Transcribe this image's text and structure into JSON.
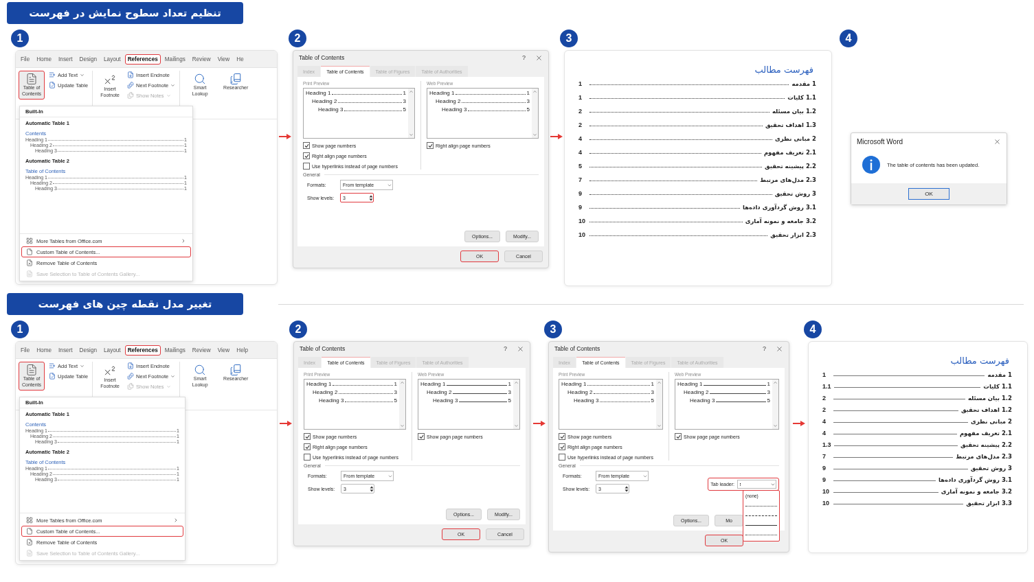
{
  "sections": [
    {
      "title": "تنظیم تعداد سطوح نمایش در فهرست",
      "steps": [
        {
          "number": "1",
          "kind": "ribbon",
          "tabs": [
            {
              "label": "File",
              "selected": false,
              "highlighted": false
            },
            {
              "label": "Home",
              "selected": false,
              "highlighted": false
            },
            {
              "label": "Insert",
              "selected": false,
              "highlighted": false
            },
            {
              "label": "Design",
              "selected": false,
              "highlighted": false
            },
            {
              "label": "Layout",
              "selected": false,
              "highlighted": false
            },
            {
              "label": "References",
              "selected": true,
              "highlighted": true
            },
            {
              "label": "Mailings",
              "selected": false,
              "highlighted": false
            },
            {
              "label": "Review",
              "selected": false,
              "highlighted": false
            },
            {
              "label": "View",
              "selected": false,
              "highlighted": false
            },
            {
              "label": "He",
              "selected": false,
              "highlighted": false
            }
          ],
          "toc_button": {
            "label": "Table of Contents",
            "highlighted": true
          },
          "toc_commands": [
            {
              "label": "Add Text",
              "dropdown": true,
              "disabled": false
            },
            {
              "label": "Update Table",
              "dropdown": false,
              "disabled": false
            }
          ],
          "footnote_button": {
            "label": "Insert Footnote"
          },
          "footnote_commands": [
            {
              "label": "Insert Endnote",
              "dropdown": false,
              "disabled": false
            },
            {
              "label": "Next Footnote",
              "dropdown": true,
              "disabled": false
            },
            {
              "label": "Show Notes",
              "dropdown": true,
              "disabled": true
            }
          ],
          "tool_buttons": [
            {
              "label": "Smart Lookup"
            },
            {
              "label": "Researcher"
            }
          ],
          "menu": {
            "header": "Built-In",
            "galleries": [
              {
                "name": "Automatic Table 1",
                "heading": "Contents",
                "entries": [
                  {
                    "label": "Heading 1",
                    "page": "1",
                    "children": [
                      {
                        "label": "Heading 2",
                        "page": "1",
                        "children": [
                          {
                            "label": "Heading 3",
                            "page": "1"
                          }
                        ]
                      }
                    ]
                  }
                ]
              },
              {
                "name": "Automatic Table 2",
                "heading": "Table of Contents",
                "entries": [
                  {
                    "label": "Heading 1",
                    "page": "1",
                    "children": [
                      {
                        "label": "Heading 2",
                        "page": "1",
                        "children": [
                          {
                            "label": "Heading 3",
                            "page": "1"
                          }
                        ]
                      }
                    ]
                  }
                ]
              }
            ],
            "items": [
              {
                "label": "More Tables from Office.com",
                "submenu": true,
                "highlighted": false,
                "disabled": false
              },
              {
                "label": "Custom Table of Contents...",
                "submenu": false,
                "highlighted": true,
                "disabled": false
              },
              {
                "label": "Remove Table of Contents",
                "submenu": false,
                "highlighted": false,
                "disabled": false
              },
              {
                "label": "Save Selection to Table of Contents Gallery...",
                "submenu": false,
                "highlighted": false,
                "disabled": true
              }
            ]
          }
        },
        {
          "number": "2",
          "kind": "dialog",
          "arrow_before": true,
          "title": "Table of Contents",
          "help": "?",
          "tabs": [
            {
              "label": "Index",
              "selected": false
            },
            {
              "label": "Table of Contents",
              "selected": true
            },
            {
              "label": "Table of Figures",
              "selected": false
            },
            {
              "label": "Table of Authorities",
              "selected": false
            }
          ],
          "print_preview": {
            "label": "Print Preview",
            "leader": {
              "kind": "dots"
            },
            "entries": [
              {
                "label": "Heading 1",
                "page": "1",
                "children": [
                  {
                    "label": "Heading 2",
                    "page": "3",
                    "children": [
                      {
                        "label": "Heading 3",
                        "page": "5"
                      }
                    ]
                  }
                ]
              }
            ]
          },
          "web_preview": {
            "label": "Web Preview",
            "leader": {
              "kind": "dots"
            },
            "entries": [
              {
                "label": "Heading 1",
                "page": "1",
                "children": [
                  {
                    "label": "Heading 2",
                    "page": "3",
                    "children": [
                      {
                        "label": "Heading 3",
                        "page": "5"
                      }
                    ]
                  }
                ]
              }
            ]
          },
          "print_options": [
            {
              "label": "Show page numbers",
              "checked": true
            },
            {
              "label": "Right align page numbers",
              "checked": true
            },
            {
              "label": "Use hyperlinks instead of page numbers",
              "checked": false
            }
          ],
          "web_options": [
            {
              "label": "Right align page numbers",
              "checked": true
            }
          ],
          "general": {
            "label": "General",
            "formats_label": "Formats:",
            "formats": "From template",
            "levels_label": "Show levels:",
            "levels": "3",
            "levels_highlighted": true
          },
          "buttons": [
            {
              "label": "Options...",
              "highlighted": false
            },
            {
              "label": "Modify...",
              "highlighted": false
            }
          ],
          "footer_buttons": [
            {
              "label": "OK",
              "highlighted": true
            },
            {
              "label": "Cancel",
              "highlighted": false
            }
          ]
        },
        {
          "number": "3",
          "kind": "toc",
          "arrow_before": true,
          "title": "فهرست مطالب",
          "leader": {
            "kind": "dots"
          },
          "entries": [
            {
              "title": "1 مقدمه",
              "page": "1"
            },
            {
              "title": "1.1 کلیات",
              "page": "1"
            },
            {
              "title": "1.2 بیان مسئله",
              "page": "2"
            },
            {
              "title": "1.3 اهداف تحقیق",
              "page": "2"
            },
            {
              "title": "2 مبانی نظری",
              "page": "4"
            },
            {
              "title": "2.1 تعریف مفهوم",
              "page": "4"
            },
            {
              "title": "2.2 پیشینه تحقیق",
              "page": "5"
            },
            {
              "title": "2.3 مدل‌های مرتبط",
              "page": "7"
            },
            {
              "title": "3 روش تحقیق",
              "page": "9"
            },
            {
              "title": "3.1 روش گردآوری داده‌ها",
              "page": "9"
            },
            {
              "title": "3.2 جامعه و نمونه آماری",
              "page": "10"
            },
            {
              "title": "2.3 ابزار تحقیق",
              "page": "10"
            }
          ]
        },
        {
          "number": "4",
          "kind": "message",
          "arrow_before": false,
          "title": "Microsoft Word",
          "message": "The table of contents has been updated.",
          "button": "OK"
        }
      ]
    },
    {
      "title": "تغییر مدل نقطه چین های فهرست",
      "steps": [
        {
          "number": "1",
          "kind": "ribbon",
          "tabs": [
            {
              "label": "File",
              "selected": false,
              "highlighted": false
            },
            {
              "label": "Home",
              "selected": false,
              "highlighted": false
            },
            {
              "label": "Insert",
              "selected": false,
              "highlighted": false
            },
            {
              "label": "Design",
              "selected": false,
              "highlighted": false
            },
            {
              "label": "Layout",
              "selected": false,
              "highlighted": false
            },
            {
              "label": "References",
              "selected": true,
              "highlighted": true
            },
            {
              "label": "Mailings",
              "selected": false,
              "highlighted": false
            },
            {
              "label": "Review",
              "selected": false,
              "highlighted": false
            },
            {
              "label": "View",
              "selected": false,
              "highlighted": false
            },
            {
              "label": "Help",
              "selected": false,
              "highlighted": false
            }
          ],
          "toc_button": {
            "label": "Table of Contents",
            "highlighted": true
          },
          "toc_commands": [
            {
              "label": "Add Text",
              "dropdown": true,
              "disabled": false
            },
            {
              "label": "Update Table",
              "dropdown": false,
              "disabled": false
            }
          ],
          "footnote_button": {
            "label": "Insert Footnote"
          },
          "footnote_commands": [
            {
              "label": "Insert Endnote",
              "dropdown": false,
              "disabled": false
            },
            {
              "label": "Next Footnote",
              "dropdown": true,
              "disabled": false
            },
            {
              "label": "Show Notes",
              "dropdown": true,
              "disabled": true
            }
          ],
          "tool_buttons": [
            {
              "label": "Smart Lookup"
            },
            {
              "label": "Researcher"
            }
          ],
          "menu": {
            "header": "Built-In",
            "galleries": [
              {
                "name": "Automatic Table 1",
                "heading": "Contents",
                "entries": [
                  {
                    "label": "Heading 1",
                    "page": "1",
                    "children": [
                      {
                        "label": "Heading 2",
                        "page": "1",
                        "children": [
                          {
                            "label": "Heading 3",
                            "page": "1"
                          }
                        ]
                      }
                    ]
                  }
                ]
              },
              {
                "name": "Automatic Table 2",
                "heading": "Table of Contents",
                "entries": [
                  {
                    "label": "Heading 1",
                    "page": "1",
                    "children": [
                      {
                        "label": "Heading 2",
                        "page": "1",
                        "children": [
                          {
                            "label": "Heading 3",
                            "page": "1"
                          }
                        ]
                      }
                    ]
                  }
                ]
              }
            ],
            "items": [
              {
                "label": "More Tables from Office.com",
                "submenu": true,
                "highlighted": false,
                "disabled": false
              },
              {
                "label": "Custom Table of Contents...",
                "submenu": false,
                "highlighted": true,
                "disabled": false
              },
              {
                "label": "Remove Table of Contents",
                "submenu": false,
                "highlighted": false,
                "disabled": false
              },
              {
                "label": "Save Selection to Table of Contents Gallery...",
                "submenu": false,
                "highlighted": false,
                "disabled": true
              }
            ]
          }
        },
        {
          "number": "2",
          "kind": "dialog",
          "arrow_before": true,
          "title": "Table of Contents",
          "help": "?",
          "tabs": [
            {
              "label": "Index",
              "selected": false
            },
            {
              "label": "Table of Contents",
              "selected": true
            },
            {
              "label": "Table of Figures",
              "selected": false
            },
            {
              "label": "Table of Authorities",
              "selected": false
            }
          ],
          "print_preview": {
            "label": "Print Preview",
            "leader": {
              "kind": "dots"
            },
            "entries": [
              {
                "label": "Heading 1",
                "page": "1",
                "children": [
                  {
                    "label": "Heading 2",
                    "page": "3",
                    "children": [
                      {
                        "label": "Heading 3",
                        "page": "5"
                      }
                    ]
                  }
                ]
              }
            ]
          },
          "web_preview": {
            "label": "Web Preview",
            "leader": {
              "kind": "line"
            },
            "entries": [
              {
                "label": "Heading 1",
                "page": "1",
                "children": [
                  {
                    "label": "Heading 2",
                    "page": "3",
                    "children": [
                      {
                        "label": "Heading 3",
                        "page": "5"
                      }
                    ]
                  }
                ]
              }
            ]
          },
          "print_options": [
            {
              "label": "Show page numbers",
              "checked": true
            },
            {
              "label": "Right align page numbers",
              "checked": true
            },
            {
              "label": "Use hyperlinks instead of page numbers",
              "checked": false
            }
          ],
          "web_options": [
            {
              "label": "Show pagn page numbers",
              "checked": true
            }
          ],
          "general": {
            "label": "General",
            "formats_label": "Formats:",
            "formats": "From template",
            "levels_label": "Show levels:",
            "levels": "3",
            "levels_highlighted": false
          },
          "buttons": [
            {
              "label": "Options...",
              "highlighted": false
            },
            {
              "label": "Modify...",
              "highlighted": false
            }
          ],
          "footer_buttons": [
            {
              "label": "OK",
              "highlighted": true
            },
            {
              "label": "Cancel",
              "highlighted": false
            }
          ]
        },
        {
          "number": "3",
          "kind": "dialog",
          "arrow_before": true,
          "title": "Table of Contents",
          "help": "?",
          "tabs": [
            {
              "label": "Index",
              "selected": false
            },
            {
              "label": "Table of Contents",
              "selected": true
            },
            {
              "label": "Table of Figures",
              "selected": false
            },
            {
              "label": "Table of Authorities",
              "selected": false
            }
          ],
          "print_preview": {
            "label": "Print Preview",
            "leader": {
              "kind": "dots"
            },
            "entries": [
              {
                "label": "Heading 1",
                "page": "1",
                "children": [
                  {
                    "label": "Heading 2",
                    "page": "3",
                    "children": [
                      {
                        "label": "Heading 3",
                        "page": "5"
                      }
                    ]
                  }
                ]
              }
            ]
          },
          "web_preview": {
            "label": "Web Preview",
            "leader": {
              "kind": "line"
            },
            "entries": [
              {
                "label": "Heading 1",
                "page": "1",
                "children": [
                  {
                    "label": "Heading 2",
                    "page": "3",
                    "children": [
                      {
                        "label": "Heading 3",
                        "page": "5"
                      }
                    ]
                  }
                ]
              }
            ]
          },
          "print_options": [
            {
              "label": "Show page numbers",
              "checked": true
            },
            {
              "label": "Right align page numbers",
              "checked": true
            },
            {
              "label": "Use hyperlinks instead of page numbers",
              "checked": false
            }
          ],
          "web_options": [
            {
              "label": "Show page page numbers",
              "checked": true
            }
          ],
          "general": {
            "label": "General",
            "formats_label": "Formats:",
            "formats": "From template",
            "levels_label": "Show levels:",
            "levels": "3",
            "levels_highlighted": false
          },
          "tab_leader": {
            "label": "Tab leader:",
            "highlighted": true,
            "leader": {
              "kind": "dots"
            },
            "options": [
              {
                "kind": "text",
                "label": "(none)"
              },
              {
                "kind": "dots"
              },
              {
                "kind": "dashes"
              },
              {
                "kind": "line"
              },
              {
                "kind": "dots"
              }
            ]
          },
          "buttons": [
            {
              "label": "Options...",
              "highlighted": false
            },
            {
              "label": "Mo",
              "highlighted": false
            }
          ],
          "footer_buttons": [
            {
              "label": "OK",
              "highlighted": true
            }
          ]
        },
        {
          "number": "4",
          "kind": "toc",
          "arrow_before": true,
          "title": "فهرست مطالب",
          "leader": {
            "kind": "line"
          },
          "entries": [
            {
              "title": "1 مقدمه",
              "page": "1"
            },
            {
              "title": "1.1 کلیات",
              "page": "1.1"
            },
            {
              "title": "1.2 بیان مسئله",
              "page": "2"
            },
            {
              "title": "1.2 اهداف تحقیق",
              "page": "2"
            },
            {
              "title": "2 مبانی نظری",
              "page": "4"
            },
            {
              "title": "2.1 تعریف مفهوم",
              "page": "4"
            },
            {
              "title": "2.2 پیشینه تحقیق",
              "page": "1.3"
            },
            {
              "title": "2.3 مدل‌های مرتبط",
              "page": "7"
            },
            {
              "title": "3 روش تحقیق",
              "page": "9"
            },
            {
              "title": "3.1 روش گردآوری داده‌ها",
              "page": "9"
            },
            {
              "title": "3.2 جامعه و نمونه آماری",
              "page": "10"
            },
            {
              "title": "3.3 ابزار تحقیق",
              "page": "10"
            }
          ]
        }
      ]
    }
  ]
}
